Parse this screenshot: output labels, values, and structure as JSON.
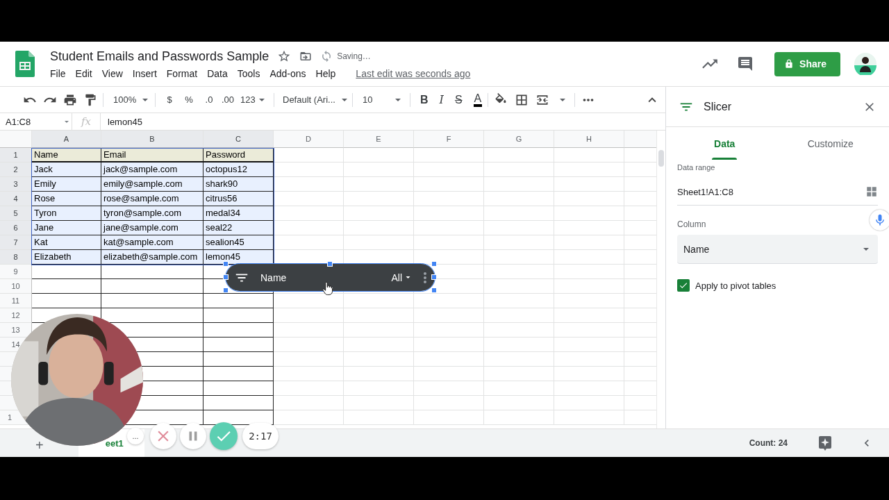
{
  "document": {
    "title": "Student Emails and Passwords Sample",
    "status": "Saving…",
    "menu": [
      "File",
      "Edit",
      "View",
      "Insert",
      "Format",
      "Data",
      "Tools",
      "Add-ons",
      "Help"
    ],
    "last_edit": "Last edit was seconds ago",
    "share": "Share"
  },
  "toolbar": {
    "zoom": "100%",
    "currency": "$",
    "percent": "%",
    "decimals_less": ".0",
    "decimals_more": ".00",
    "number_format": "123",
    "font": "Default (Ari...",
    "font_size": "10",
    "bold": "B",
    "italic": "I",
    "strike": "S",
    "text_color": "A"
  },
  "formula_bar": {
    "name_box": "A1:C8",
    "fx": "fx",
    "value": "lemon45"
  },
  "sheet": {
    "columns": [
      "A",
      "B",
      "C",
      "D",
      "E",
      "F",
      "G",
      "H"
    ],
    "rows": [
      {
        "number": "1",
        "kind": "header",
        "cells": [
          "Name",
          "Email",
          "Password"
        ]
      },
      {
        "number": "2",
        "kind": "data",
        "cells": [
          "Jack",
          "jack@sample.com",
          "octopus12"
        ]
      },
      {
        "number": "3",
        "kind": "data",
        "cells": [
          "Emily",
          "emily@sample.com",
          "shark90"
        ]
      },
      {
        "number": "4",
        "kind": "data",
        "cells": [
          "Rose",
          "rose@sample.com",
          "citrus56"
        ]
      },
      {
        "number": "5",
        "kind": "data",
        "cells": [
          "Tyron",
          "tyron@sample.com",
          "medal34"
        ]
      },
      {
        "number": "6",
        "kind": "data",
        "cells": [
          "Jane",
          "jane@sample.com",
          "seal22"
        ]
      },
      {
        "number": "7",
        "kind": "data",
        "cells": [
          "Kat",
          "kat@sample.com",
          "sealion45"
        ]
      },
      {
        "number": "8",
        "kind": "data",
        "cells": [
          "Elizabeth",
          "elizabeth@sample.com",
          "lemon45"
        ]
      }
    ],
    "empty_rows": [
      "9",
      "10",
      "11",
      "12",
      "13",
      "14"
    ],
    "partial_row_number": "1"
  },
  "slicer_chip": {
    "column": "Name",
    "value": "All",
    "selected": true
  },
  "slicer_panel": {
    "title": "Slicer",
    "tabs": [
      {
        "label": "Data",
        "selected": true
      },
      {
        "label": "Customize",
        "selected": false
      }
    ],
    "data_range_label": "Data range",
    "data_range": "Sheet1!A1:C8",
    "column_label": "Column",
    "column_value": "Name",
    "apply_pivot": {
      "label": "Apply to pivot tables",
      "checked": true
    }
  },
  "bottom_bar": {
    "add": "+",
    "sheet_tab": "eet1",
    "count": "Count: 24"
  },
  "recorder": {
    "more": "...",
    "timer": "2:17"
  }
}
